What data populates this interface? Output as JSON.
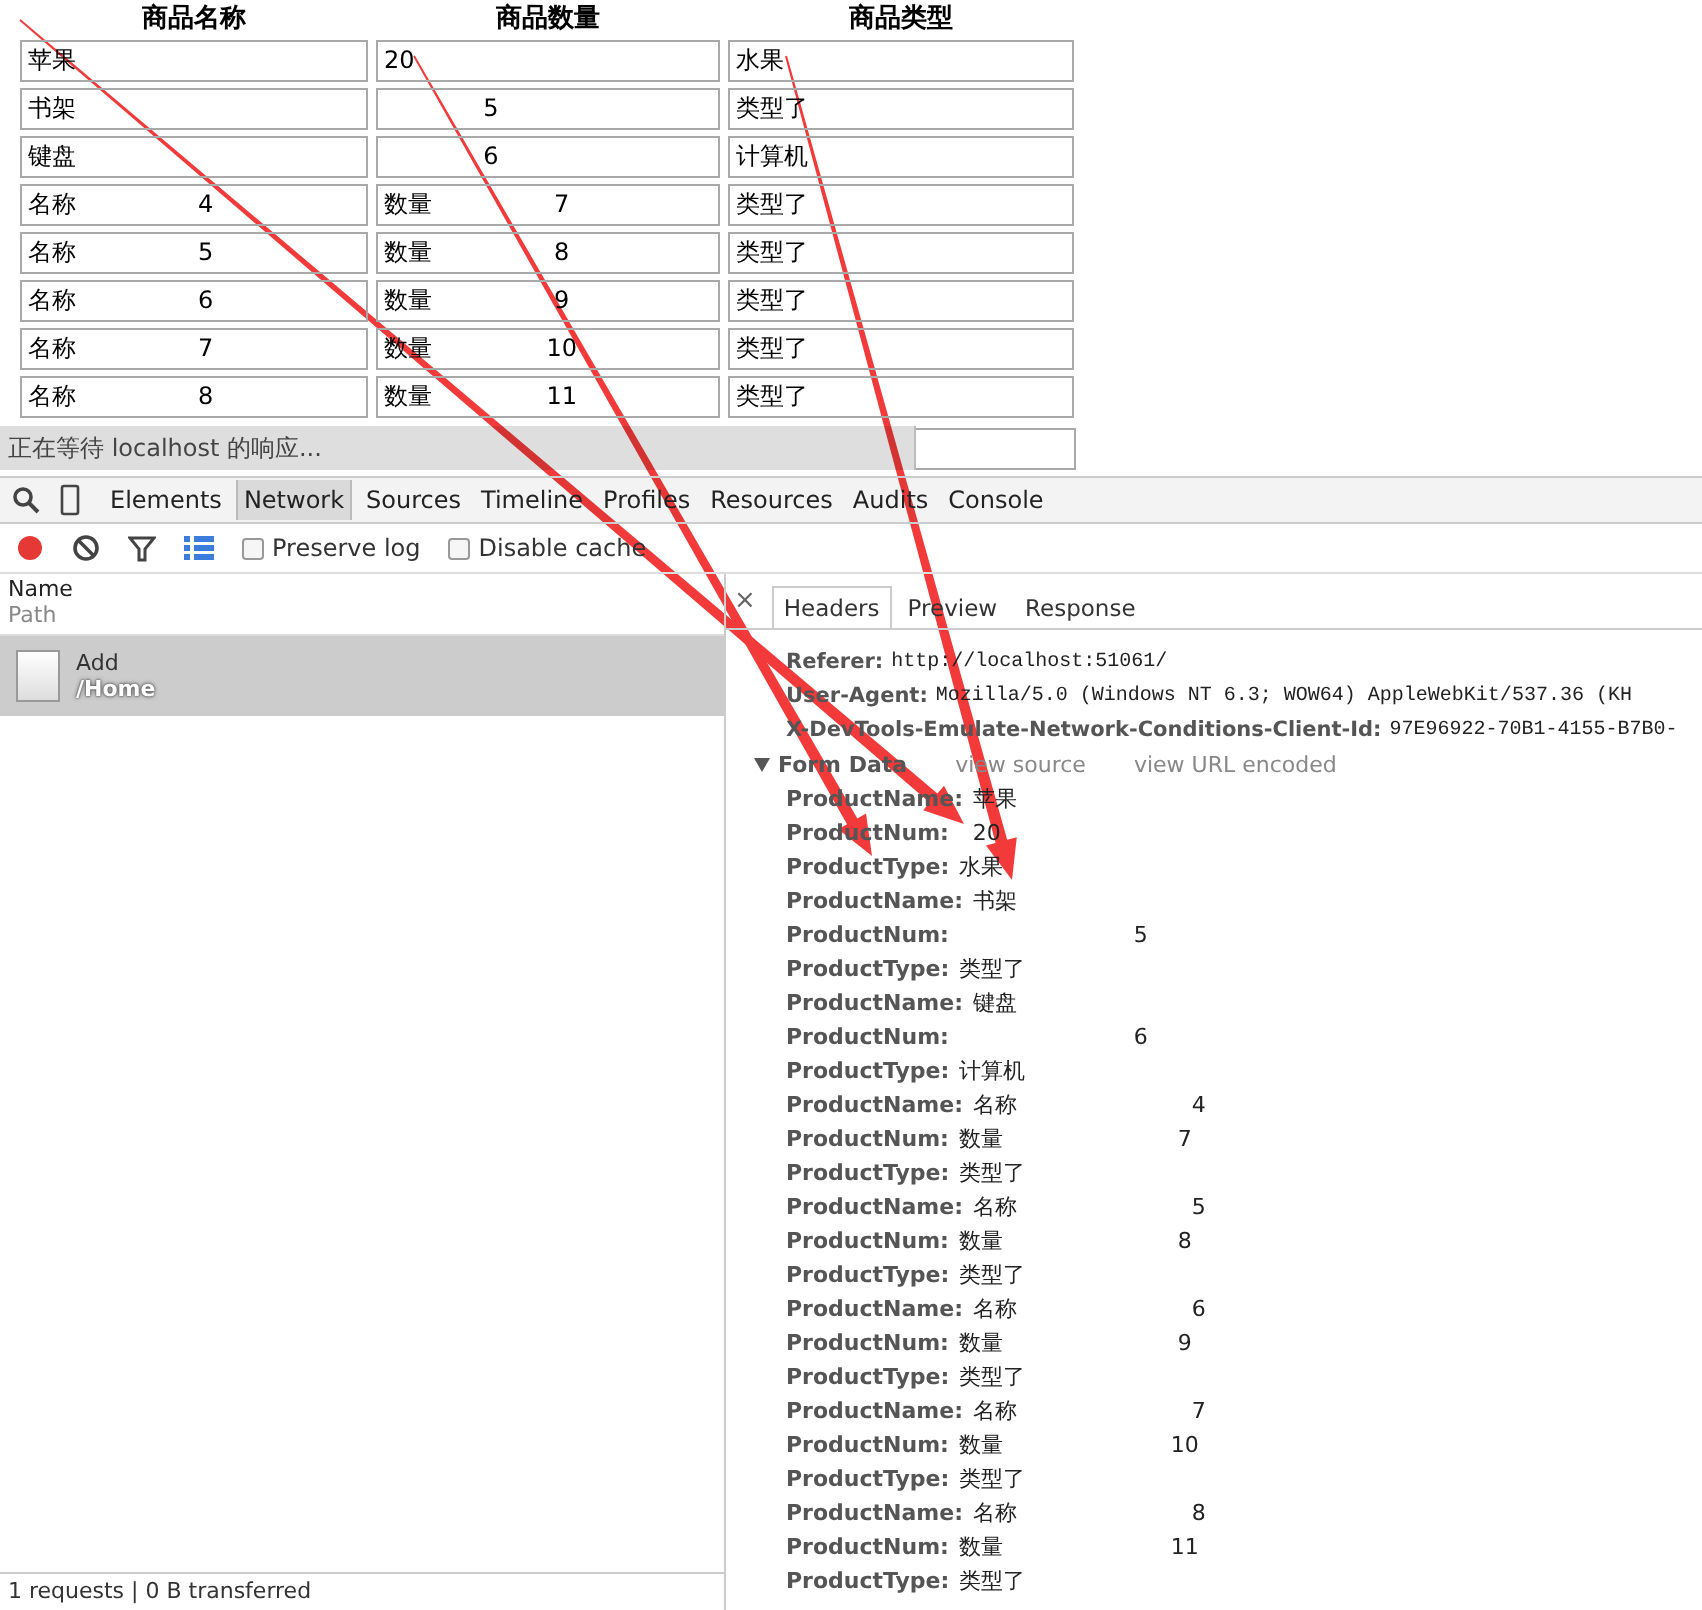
{
  "form_table": {
    "columns": [
      "商品名称",
      "商品数量",
      "商品类型"
    ],
    "rows": [
      [
        "苹果",
        "20",
        "水果"
      ],
      [
        "书架",
        "             5",
        "类型了"
      ],
      [
        "键盘",
        "             6",
        "计算机"
      ],
      [
        "名称                4",
        "数量                7",
        "类型了"
      ],
      [
        "名称                5",
        "数量                8",
        "类型了"
      ],
      [
        "名称                6",
        "数量                9",
        "类型了"
      ],
      [
        "名称                7",
        "数量               10",
        "类型了"
      ],
      [
        "名称                8",
        "数量               11",
        "类型了"
      ]
    ]
  },
  "loading_status": "正在等待 localhost 的响应...",
  "devtools": {
    "tabs": [
      {
        "label": "Elements",
        "selected": false
      },
      {
        "label": "Network",
        "selected": true
      },
      {
        "label": "Sources",
        "selected": false
      },
      {
        "label": "Timeline",
        "selected": false
      },
      {
        "label": "Profiles",
        "selected": false
      },
      {
        "label": "Resources",
        "selected": false
      },
      {
        "label": "Audits",
        "selected": false
      },
      {
        "label": "Console",
        "selected": false
      }
    ],
    "recording": true,
    "checkboxes": [
      {
        "label": "Preserve log",
        "checked": false
      },
      {
        "label": "Disable cache",
        "checked": false
      }
    ],
    "list_header": {
      "name": "Name",
      "path": "Path"
    },
    "requests": [
      {
        "name": "Add",
        "path": "/Home",
        "selected": true
      }
    ],
    "status_bar": "1 requests | 0 B transferred",
    "close_label": "×",
    "detail_tabs": [
      {
        "label": "Headers",
        "selected": true
      },
      {
        "label": "Preview",
        "selected": false
      },
      {
        "label": "Response",
        "selected": false
      }
    ],
    "request_headers": [
      {
        "key": "Referer:",
        "value": "http://localhost:51061/"
      },
      {
        "key": "User-Agent:",
        "value": "Mozilla/5.0 (Windows NT 6.3; WOW64) AppleWebKit/537.36 (KH"
      },
      {
        "key": "X-DevTools-Emulate-Network-Conditions-Client-Id:",
        "value": "97E96922-70B1-4155-B7B0-"
      }
    ],
    "form_data": {
      "title": "Form Data",
      "expanded": true,
      "links": [
        "view source",
        "view URL encoded"
      ],
      "fields": [
        {
          "key": "ProductName:",
          "value": "苹果"
        },
        {
          "key": "ProductNum:",
          "value": "  20"
        },
        {
          "key": "ProductType:",
          "value": "水果"
        },
        {
          "key": "ProductName:",
          "value": "书架"
        },
        {
          "key": "ProductNum:",
          "value": "                         5"
        },
        {
          "key": "ProductType:",
          "value": "类型了"
        },
        {
          "key": "ProductName:",
          "value": "键盘"
        },
        {
          "key": "ProductNum:",
          "value": "                         6"
        },
        {
          "key": "ProductType:",
          "value": "计算机"
        },
        {
          "key": "ProductName:",
          "value": "名称                         4"
        },
        {
          "key": "ProductNum:",
          "value": "数量                         7"
        },
        {
          "key": "ProductType:",
          "value": "类型了"
        },
        {
          "key": "ProductName:",
          "value": "名称                         5"
        },
        {
          "key": "ProductNum:",
          "value": "数量                         8"
        },
        {
          "key": "ProductType:",
          "value": "类型了"
        },
        {
          "key": "ProductName:",
          "value": "名称                         6"
        },
        {
          "key": "ProductNum:",
          "value": "数量                         9"
        },
        {
          "key": "ProductType:",
          "value": "类型了"
        },
        {
          "key": "ProductName:",
          "value": "名称                         7"
        },
        {
          "key": "ProductNum:",
          "value": "数量                        10"
        },
        {
          "key": "ProductType:",
          "value": "类型了"
        },
        {
          "key": "ProductName:",
          "value": "名称                         8"
        },
        {
          "key": "ProductNum:",
          "value": "数量                        11"
        },
        {
          "key": "ProductType:",
          "value": "类型了"
        }
      ]
    }
  }
}
